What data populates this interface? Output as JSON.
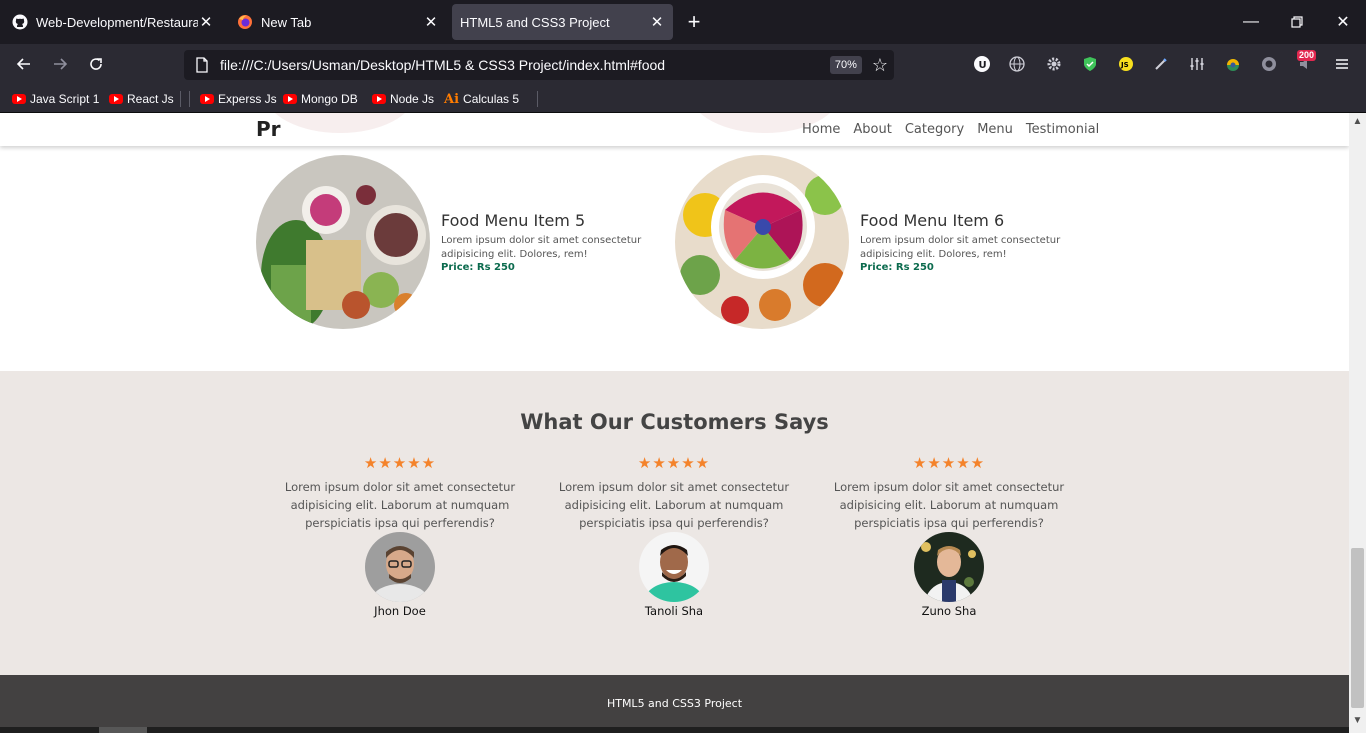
{
  "browser": {
    "tabs": [
      {
        "title": "Web-Development/Restaurant",
        "icon": "github-icon",
        "active": false
      },
      {
        "title": "New Tab",
        "icon": "firefox-icon",
        "active": false
      },
      {
        "title": "HTML5 and CSS3 Project",
        "icon": "none",
        "active": true
      }
    ],
    "url": "file:///C:/Users/Usman/Desktop/HTML5 & CSS3 Project/index.html#food",
    "zoom": "70%",
    "extension_badge": "200",
    "bookmarks": [
      {
        "label": "Java Script 1",
        "icon": "youtube-icon"
      },
      {
        "label": "React Js",
        "icon": "youtube-icon"
      },
      {
        "label": "Experss Js",
        "icon": "youtube-icon"
      },
      {
        "label": "Mongo DB",
        "icon": "youtube-icon"
      },
      {
        "label": "Node Js",
        "icon": "youtube-icon"
      },
      {
        "label": "Calculas 5",
        "icon": "illustrator-icon"
      }
    ]
  },
  "site": {
    "logo": "Pr",
    "nav": [
      "Home",
      "About",
      "Category",
      "Menu",
      "Testimonial"
    ],
    "food_items": [
      {
        "title": "Food Menu Item 5",
        "desc": "Lorem ipsum dolor sit amet consectetur adipisicing elit. Dolores, rem!",
        "price": "Price: Rs 250"
      },
      {
        "title": "Food Menu Item 6",
        "desc": "Lorem ipsum dolor sit amet consectetur adipisicing elit. Dolores, rem!",
        "price": "Price: Rs 250"
      }
    ],
    "testimonials": {
      "title": "What Our Customers Says",
      "items": [
        {
          "stars": "★★★★★",
          "text": "Lorem ipsum dolor sit amet consectetur adipisicing elit. Laborum at numquam perspiciatis ipsa qui perferendis?",
          "name": "Jhon Doe"
        },
        {
          "stars": "★★★★★",
          "text": "Lorem ipsum dolor sit amet consectetur adipisicing elit. Laborum at numquam perspiciatis ipsa qui perferendis?",
          "name": "Tanoli Sha"
        },
        {
          "stars": "★★★★★",
          "text": "Lorem ipsum dolor sit amet consectetur adipisicing elit. Laborum at numquam perspiciatis ipsa qui perferendis?",
          "name": "Zuno Sha"
        }
      ]
    },
    "footer": "HTML5 and CSS3 Project"
  },
  "colors": {
    "star": "#f4832b",
    "price": "#0c6b4e",
    "testimonial_bg": "#ece7e4",
    "footer_bg": "#434141"
  }
}
